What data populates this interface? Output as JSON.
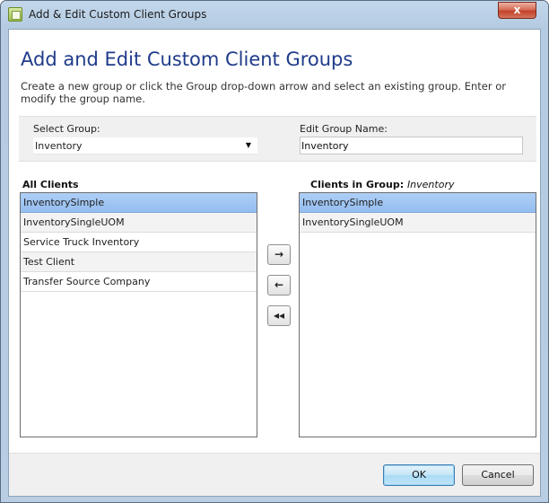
{
  "window": {
    "title": "Add & Edit Custom Client Groups",
    "close_glyph": "x",
    "icon": "app-icon"
  },
  "header": {
    "heading": "Add and Edit Custom Client Groups",
    "instructions": "Create a new group or click the Group drop-down arrow and select an existing group. Enter or modify the group name."
  },
  "group": {
    "select_label": "Select Group:",
    "selected_value": "Inventory",
    "edit_label": "Edit Group Name:",
    "edit_value": "Inventory"
  },
  "all_clients": {
    "title": "All Clients",
    "items": [
      {
        "label": "InventorySimple",
        "selected": true
      },
      {
        "label": "InventorySingleUOM",
        "selected": false
      },
      {
        "label": "Service Truck Inventory",
        "selected": false
      },
      {
        "label": "Test Client",
        "selected": false
      },
      {
        "label": "Transfer Source Company",
        "selected": false
      }
    ]
  },
  "group_clients": {
    "title_prefix": "Clients in Group:",
    "title_group": "Inventory",
    "items": [
      {
        "label": "InventorySimple",
        "selected": true
      },
      {
        "label": "InventorySingleUOM",
        "selected": false
      }
    ]
  },
  "move_buttons": {
    "add_glyph": "→",
    "remove_glyph": "←",
    "remove_all_glyph": "◂◂"
  },
  "footer": {
    "ok_label": "OK",
    "cancel_label": "Cancel"
  }
}
